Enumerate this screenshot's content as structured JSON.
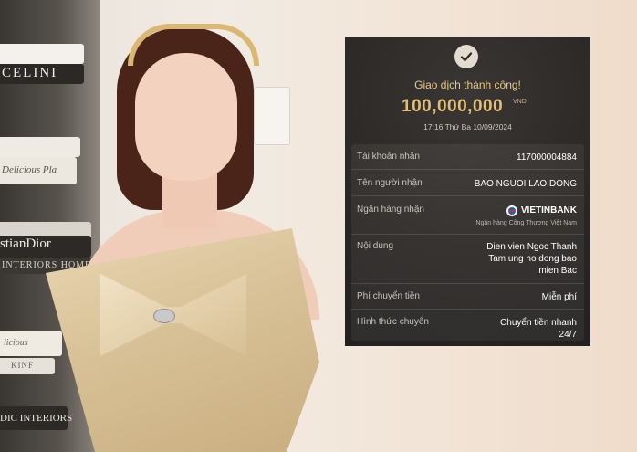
{
  "background": {
    "books": [
      "CELINI",
      "Delicious Pla",
      "stianDior",
      "INTERIORS HOMES",
      "licious",
      "KINF",
      "DIC INTERIORS"
    ]
  },
  "receipt": {
    "status_icon": "checkmark-icon",
    "status_text": "Giao dịch thành công!",
    "amount": "100,000,000",
    "currency": "VND",
    "datetime": "17:16 Thứ Ba 10/09/2024",
    "rows": {
      "account": {
        "label": "Tài khoản nhận",
        "value": "117000004884"
      },
      "recipient": {
        "label": "Tên người nhận",
        "value": "BAO NGUOI LAO DONG"
      },
      "bank": {
        "label": "Ngân hàng nhận",
        "value": "VIETINBANK",
        "sub": "Ngân hàng Công Thương Việt Nam"
      },
      "content": {
        "label": "Nội dung",
        "line1": "Dien vien Ngoc Thanh",
        "line2": "Tam ung ho dong bao",
        "line3": "mien Bac"
      },
      "fee": {
        "label": "Phí chuyển tiền",
        "value": "Miễn phí"
      },
      "method": {
        "label": "Hình thức chuyển",
        "line1": "Chuyển tiền nhanh",
        "line2": "24/7"
      }
    }
  },
  "colors": {
    "card_bg": "#2a2725",
    "accent_gold": "#e0bf79",
    "bank_blue": "#1d5fb4"
  }
}
